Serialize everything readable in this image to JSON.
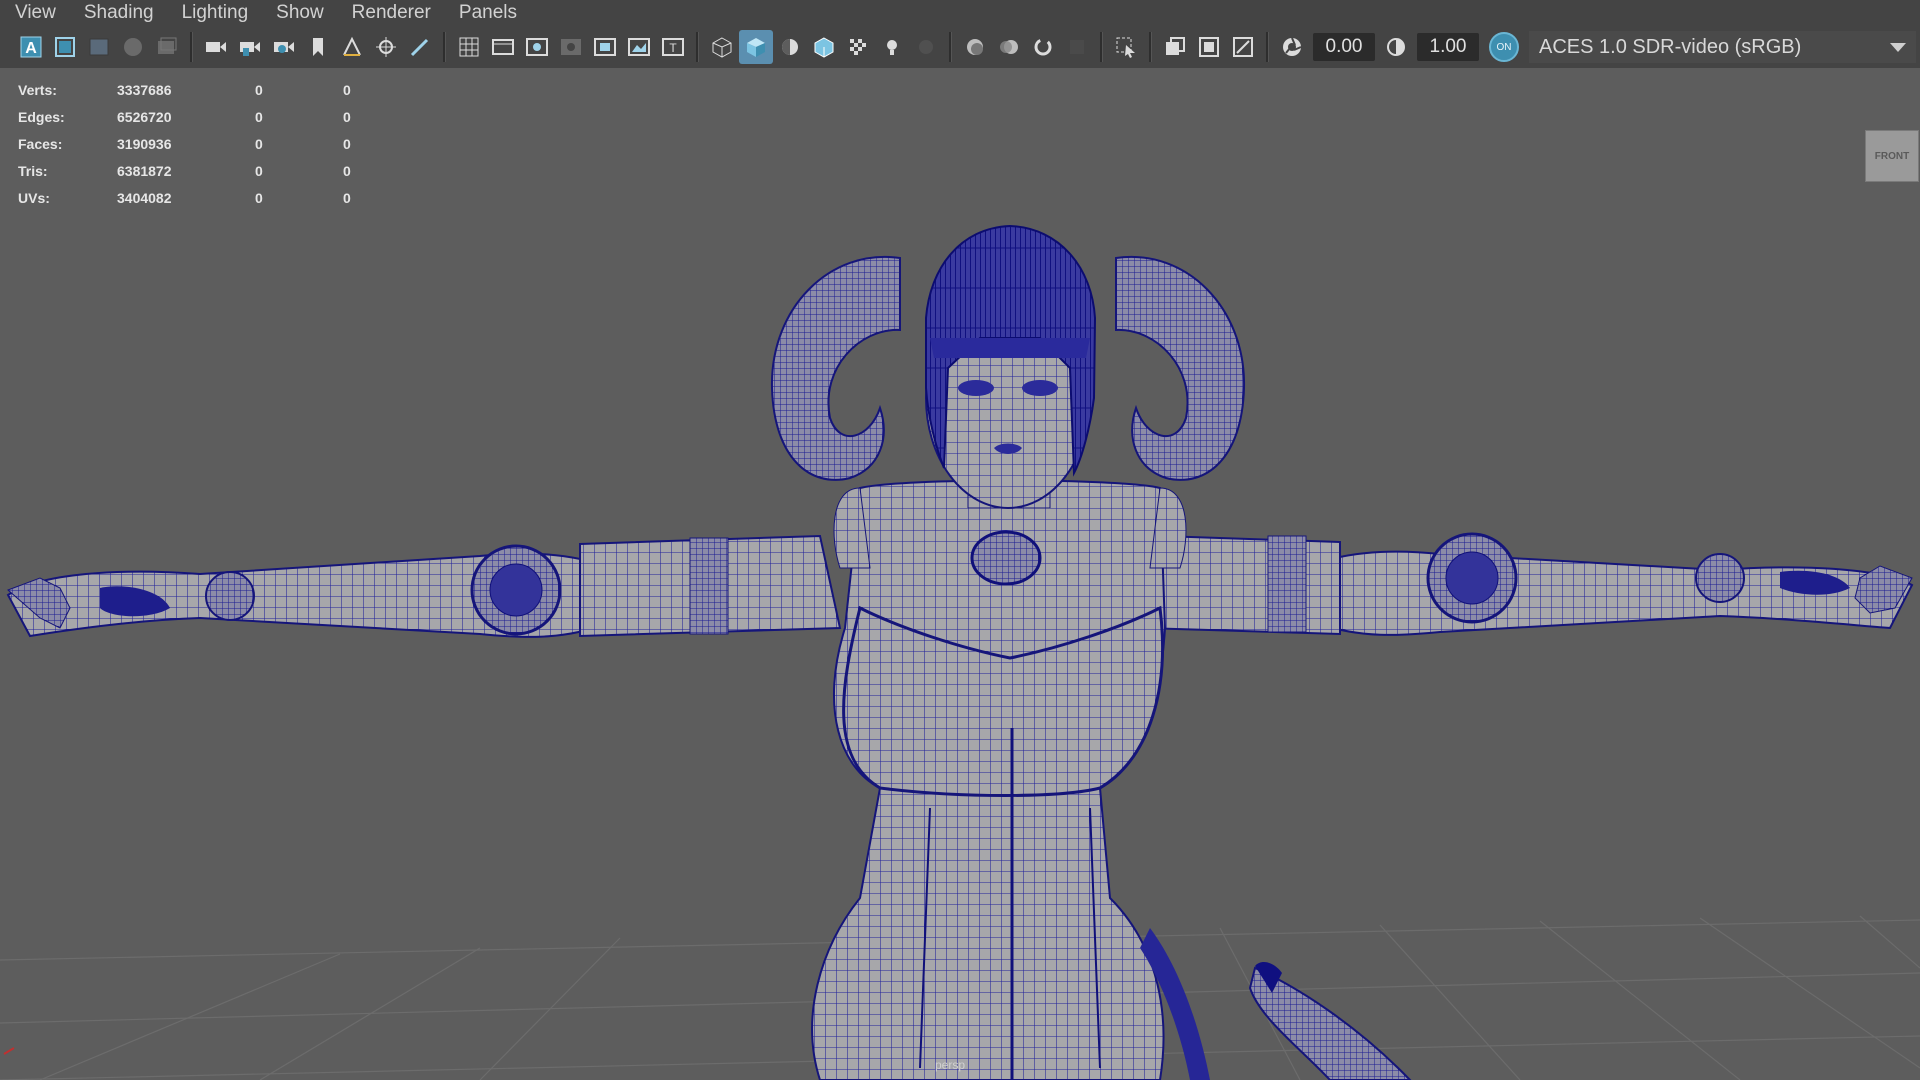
{
  "menus": [
    "View",
    "Shading",
    "Lighting",
    "Show",
    "Renderer",
    "Panels"
  ],
  "toolbar": {
    "exposure_value": "0.00",
    "gamma_value": "1.00",
    "color_mgmt_toggle": "ON",
    "color_space": "ACES 1.0 SDR-video (sRGB)"
  },
  "hud": {
    "rows": [
      {
        "label": "Verts:",
        "value": "3337686",
        "col2": "0",
        "col3": "0"
      },
      {
        "label": "Edges:",
        "value": "6526720",
        "col2": "0",
        "col3": "0"
      },
      {
        "label": "Faces:",
        "value": "3190936",
        "col2": "0",
        "col3": "0"
      },
      {
        "label": "Tris:",
        "value": "6381872",
        "col2": "0",
        "col3": "0"
      },
      {
        "label": "UVs:",
        "value": "3404082",
        "col2": "0",
        "col3": "0"
      }
    ]
  },
  "viewcube_label": "FRONT",
  "camera_label": "persp",
  "colors": {
    "background": "#5d5d5d",
    "toolbar": "#444444",
    "wireframe": "#1e1e8c",
    "active_highlight": "#5b8fb0"
  }
}
